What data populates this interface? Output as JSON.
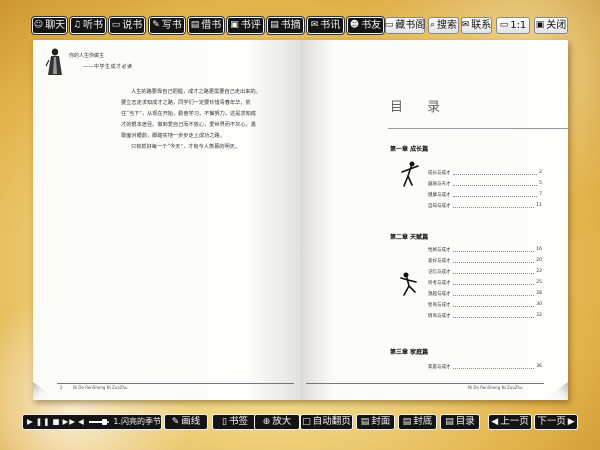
{
  "toolbar": {
    "chat": "聊天",
    "listen": "听书",
    "tell": "说书",
    "write": "写书",
    "borrow": "借书",
    "review": "书评",
    "rating": "书摘",
    "discuss": "书讯",
    "friends": "书友",
    "collection": "藏书阁",
    "search": "搜索",
    "contact": "联系",
    "ratio": "1:1",
    "close": "关闭"
  },
  "left_page": {
    "head_title": "你的人生你做主",
    "head_sub": "——中学生成才必读",
    "paragraphs": [
      "人生的路要靠自己把握，成才之路更需要自己走出来的。要立志走求知成才之路，同学们一定要珍惜青春年华，抓住“当下”，从现在开始，勤奋学习，不懈努力。这是求知成才的根本途径。做到爱自己而不放心，爱世界而不灰心，勇敢面对眼前，脚踏实地一步步走上成功之路。",
      "只有抓好每一个“今天”，才有今人羡慕的明天。"
    ],
    "page_number": "2",
    "footer_text": "Ni De RenSheng Ni ZuoZhu"
  },
  "right_page": {
    "toc_title": "目 录",
    "chapters": [
      {
        "title": "第一章  成长篇",
        "entries": [
          {
            "title": "成长与成才",
            "page": "2"
          },
          {
            "title": "器质与天才",
            "page": "5"
          },
          {
            "title": "健康与成才",
            "page": "7"
          },
          {
            "title": "自知与成才",
            "page": "11"
          }
        ]
      },
      {
        "title": "第二章  天赋篇",
        "entries": [
          {
            "title": "性格与成才",
            "page": "16"
          },
          {
            "title": "爱好与成才",
            "page": "20"
          },
          {
            "title": "记忆与成才",
            "page": "22"
          },
          {
            "title": "听考与成才",
            "page": "25"
          },
          {
            "title": "激越与成才",
            "page": "28"
          },
          {
            "title": "智商与成才",
            "page": "30"
          },
          {
            "title": "情商与成才",
            "page": "32"
          }
        ]
      },
      {
        "title": "第三章  家庭篇",
        "entries": [
          {
            "title": "家庭与成才",
            "page": "36"
          }
        ]
      }
    ],
    "footer_text": "Ni De RenSheng Ni ZuoZhu"
  },
  "bottombar": {
    "track": "1.闪亮的季节",
    "draw": "画线",
    "bookmark": "书签",
    "zoom": "放大",
    "autoflip": "自动翻页",
    "cover": "封面",
    "backcover": "封底",
    "toc": "目录",
    "prev": "上一页",
    "next": "下一页"
  },
  "colors": {
    "button_bg": "#141414",
    "button_border": "#f4f4f4",
    "background_gold": "#e2b24a"
  },
  "volume": 0.65
}
